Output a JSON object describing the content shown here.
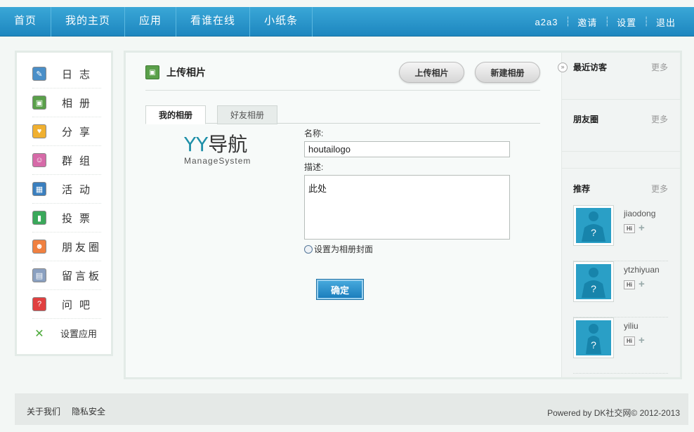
{
  "topnav": {
    "items": [
      "首页",
      "我的主页",
      "应用",
      "看谁在线",
      "小纸条"
    ],
    "user": "a2a3",
    "invite": "邀请",
    "settings": "设置",
    "logout": "退出"
  },
  "sidebar": {
    "items": [
      {
        "label": "日志",
        "icon": "blog-icon",
        "color": "#4a8fc8"
      },
      {
        "label": "相册",
        "icon": "album-icon",
        "color": "#5aa04a"
      },
      {
        "label": "分享",
        "icon": "share-icon",
        "color": "#f0b030"
      },
      {
        "label": "群组",
        "icon": "group-icon",
        "color": "#d66aa8"
      },
      {
        "label": "活动",
        "icon": "event-icon",
        "color": "#3a7fbf"
      },
      {
        "label": "投票",
        "icon": "poll-icon",
        "color": "#3aa85a"
      },
      {
        "label": "朋友圈",
        "icon": "friends-icon",
        "color": "#f08040"
      },
      {
        "label": "留言板",
        "icon": "guestbook-icon",
        "color": "#8aa0c0"
      },
      {
        "label": "问吧",
        "icon": "question-icon",
        "color": "#e04040"
      },
      {
        "label": "设置应用",
        "icon": "tools-icon",
        "color": "#4caa3a"
      }
    ]
  },
  "main": {
    "title": "上传相片",
    "upload_button": "上传相片",
    "new_album_button": "新建相册",
    "tabs": [
      "我的相册",
      "好友相册"
    ],
    "logo": {
      "yy": "YY",
      "nav": "导航",
      "sub": "ManageSystem"
    },
    "form": {
      "name_label": "名称:",
      "name_value": "houtailogo",
      "desc_label": "描述:",
      "desc_value": "此处",
      "cover_label": "设置为相册封面",
      "submit": "确定"
    }
  },
  "right": {
    "visitors": {
      "title": "最近访客",
      "more": "更多"
    },
    "circle": {
      "title": "朋友圈",
      "more": "更多"
    },
    "recommend": {
      "title": "推荐",
      "more": "更多",
      "hi_label": "Hi",
      "plus_label": "+",
      "users": [
        {
          "name": "jiaodong"
        },
        {
          "name": "ytzhiyuan"
        },
        {
          "name": "yiliu"
        }
      ]
    }
  },
  "footer": {
    "about": "关于我们",
    "privacy": "隐私安全",
    "copyright": "Powered by DK社交网© 2012-2013"
  },
  "colors": {
    "nav_bg": "#2496cc",
    "button_blue": "#1b7ebd",
    "avatar_blue": "#2a9fc6"
  }
}
